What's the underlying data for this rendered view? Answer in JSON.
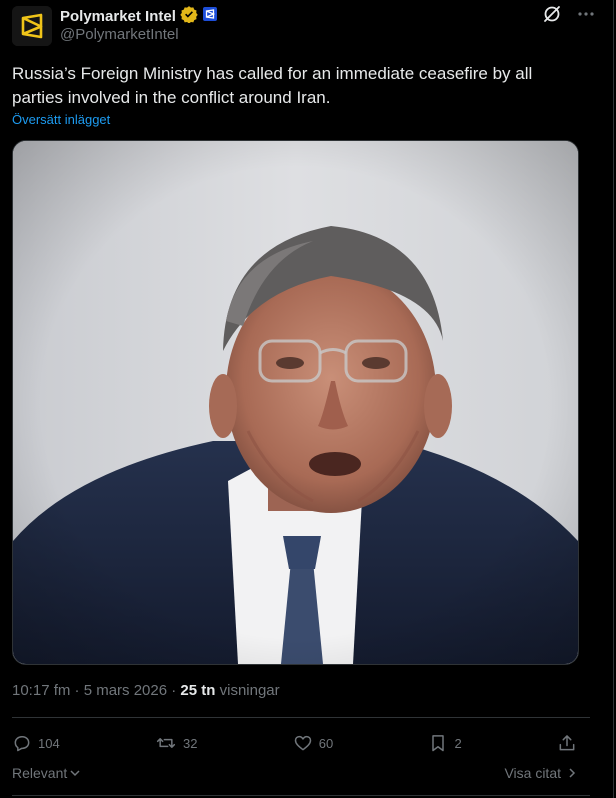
{
  "author": {
    "display_name": "Polymarket Intel",
    "handle": "@PolymarketIntel"
  },
  "icons": {
    "avatar": "polymarket-logo",
    "verified": "gold-verified-badge",
    "affiliate": "affiliate-badge",
    "grok": "grok-icon",
    "more": "more-icon"
  },
  "tweet": {
    "text": "Russia’s Foreign Ministry has called for an immediate ceasefire by all parties involved in the conflict around Iran.",
    "translate_label": "Översätt inlägget"
  },
  "meta": {
    "timestamp": "10:17 fm · 5 mars 2026",
    "separator": " · ",
    "views_count": "25 tn",
    "views_label": "visningar"
  },
  "actions": {
    "replies": "104",
    "reposts": "32",
    "likes": "60",
    "bookmarks": "2"
  },
  "footer": {
    "sort_label": "Relevant",
    "quotes_label": "Visa citat"
  },
  "colors": {
    "background": "#000000",
    "text": "#e7e9ea",
    "muted": "#71767b",
    "link": "#1d9bf0",
    "verified_gold": "#e2b719",
    "affiliate_blue": "#1d4ed8"
  }
}
